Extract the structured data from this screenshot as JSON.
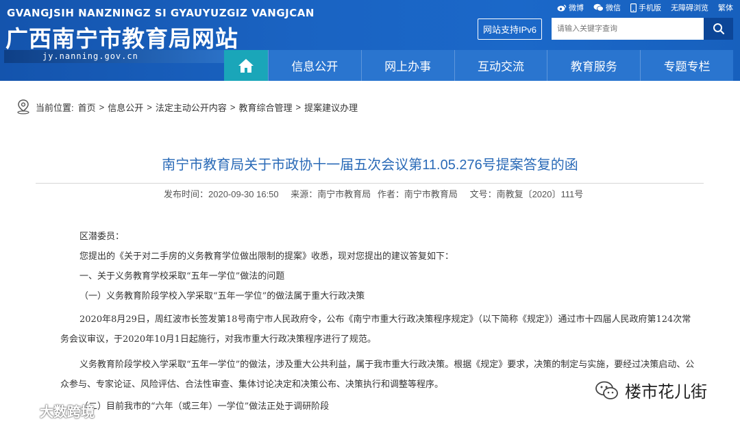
{
  "header": {
    "pinyin": "GVANGJSIH NANZNINGZ SI GYAUYUZGIZ VANGJCAN",
    "site_title": "广西南宁市教育局网站",
    "domain": "jy.nanning.gov.cn",
    "top_links": [
      "微博",
      "微信",
      "手机版",
      "无障碍浏览",
      "繁体"
    ],
    "ipv6_label": "网站支持IPv6",
    "search_placeholder": "请输入关键字查询"
  },
  "nav": {
    "items": [
      "信息公开",
      "网上办事",
      "互动交流",
      "教育服务",
      "专题专栏"
    ]
  },
  "breadcrumb": {
    "label": "当前位置:",
    "items": [
      "首页",
      "信息公开",
      "法定主动公开内容",
      "教育综合管理",
      "提案建议办理"
    ]
  },
  "article": {
    "title": "南宁市教育局关于市政协十一届五次会议第11.05.276号提案答复的函",
    "publish_time": "发布时间：2020-09-30 16:50",
    "source": "来源：南宁市教育局",
    "author": "作者：南宁市教育局",
    "doc_no": "文号：南教复〔2020〕111号",
    "paragraphs": [
      "区潜委员：",
      "您提出的《关于对二手房的义务教育学位做出限制的提案》收悉，现对您提出的建议答复如下：",
      "一、关于义务教育学校采取“五年一学位”做法的问题",
      "（一）义务教育阶段学校入学采取“五年一学位”的做法属于重大行政决策",
      "2020年8月29日，周红波市长签发第18号南宁市人民政府令，公布《南宁市重大行政决策程序规定》（以下简称《规定》）通过市十四届人民政府第124次常务会议审议，于2020年10月1日起施行，对我市重大行政决策程序进行了规范。",
      "义务教育阶段学校入学采取“五年一学位”的做法，涉及重大公共利益，属于我市重大行政决策。根据《规定》要求，决策的制定与实施，要经过决策启动、公众参与、专家论证、风险评估、合法性审查、集体讨论决定和决策公布、决策执行和调整等程序。",
      "（二）目前我市的“六年（或三年）一学位”做法正处于调研阶段"
    ]
  },
  "watermarks": {
    "left": "大数跨境",
    "right": "楼市花儿街"
  }
}
